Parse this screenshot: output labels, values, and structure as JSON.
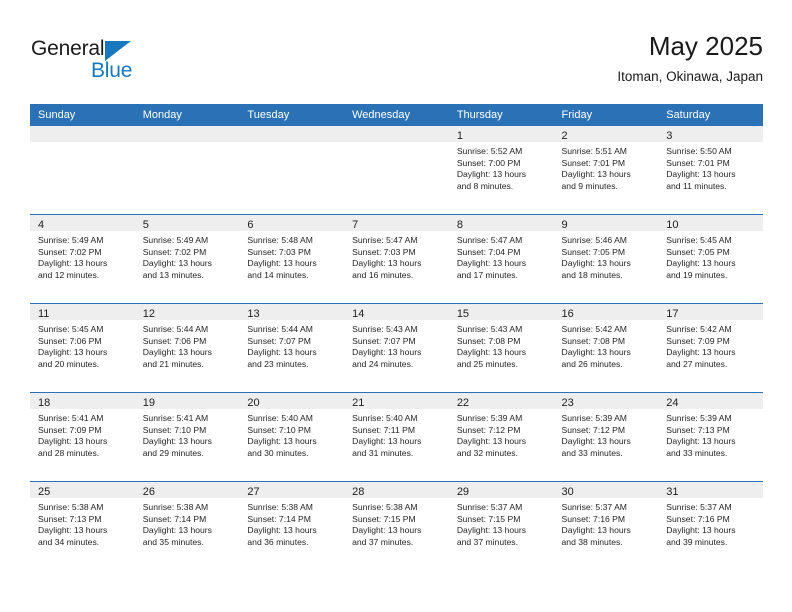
{
  "brand": {
    "name_part1": "General",
    "name_part2": "Blue",
    "triangle_color": "#1878be"
  },
  "header": {
    "title": "May 2025",
    "subtitle": "Itoman, Okinawa, Japan"
  },
  "theme": {
    "header_bg": "#2a72b5",
    "daynum_bg": "#eeeeee",
    "row_divider": "#2a72b5",
    "text": "#252525"
  },
  "calendar": {
    "weekday_headers": [
      "Sunday",
      "Monday",
      "Tuesday",
      "Wednesday",
      "Thursday",
      "Friday",
      "Saturday"
    ],
    "weeks": [
      [
        {
          "day": "",
          "lines": []
        },
        {
          "day": "",
          "lines": []
        },
        {
          "day": "",
          "lines": []
        },
        {
          "day": "",
          "lines": []
        },
        {
          "day": "1",
          "lines": [
            "Sunrise: 5:52 AM",
            "Sunset: 7:00 PM",
            "Daylight: 13 hours",
            "and 8 minutes."
          ]
        },
        {
          "day": "2",
          "lines": [
            "Sunrise: 5:51 AM",
            "Sunset: 7:01 PM",
            "Daylight: 13 hours",
            "and 9 minutes."
          ]
        },
        {
          "day": "3",
          "lines": [
            "Sunrise: 5:50 AM",
            "Sunset: 7:01 PM",
            "Daylight: 13 hours",
            "and 11 minutes."
          ]
        }
      ],
      [
        {
          "day": "4",
          "lines": [
            "Sunrise: 5:49 AM",
            "Sunset: 7:02 PM",
            "Daylight: 13 hours",
            "and 12 minutes."
          ]
        },
        {
          "day": "5",
          "lines": [
            "Sunrise: 5:49 AM",
            "Sunset: 7:02 PM",
            "Daylight: 13 hours",
            "and 13 minutes."
          ]
        },
        {
          "day": "6",
          "lines": [
            "Sunrise: 5:48 AM",
            "Sunset: 7:03 PM",
            "Daylight: 13 hours",
            "and 14 minutes."
          ]
        },
        {
          "day": "7",
          "lines": [
            "Sunrise: 5:47 AM",
            "Sunset: 7:03 PM",
            "Daylight: 13 hours",
            "and 16 minutes."
          ]
        },
        {
          "day": "8",
          "lines": [
            "Sunrise: 5:47 AM",
            "Sunset: 7:04 PM",
            "Daylight: 13 hours",
            "and 17 minutes."
          ]
        },
        {
          "day": "9",
          "lines": [
            "Sunrise: 5:46 AM",
            "Sunset: 7:05 PM",
            "Daylight: 13 hours",
            "and 18 minutes."
          ]
        },
        {
          "day": "10",
          "lines": [
            "Sunrise: 5:45 AM",
            "Sunset: 7:05 PM",
            "Daylight: 13 hours",
            "and 19 minutes."
          ]
        }
      ],
      [
        {
          "day": "11",
          "lines": [
            "Sunrise: 5:45 AM",
            "Sunset: 7:06 PM",
            "Daylight: 13 hours",
            "and 20 minutes."
          ]
        },
        {
          "day": "12",
          "lines": [
            "Sunrise: 5:44 AM",
            "Sunset: 7:06 PM",
            "Daylight: 13 hours",
            "and 21 minutes."
          ]
        },
        {
          "day": "13",
          "lines": [
            "Sunrise: 5:44 AM",
            "Sunset: 7:07 PM",
            "Daylight: 13 hours",
            "and 23 minutes."
          ]
        },
        {
          "day": "14",
          "lines": [
            "Sunrise: 5:43 AM",
            "Sunset: 7:07 PM",
            "Daylight: 13 hours",
            "and 24 minutes."
          ]
        },
        {
          "day": "15",
          "lines": [
            "Sunrise: 5:43 AM",
            "Sunset: 7:08 PM",
            "Daylight: 13 hours",
            "and 25 minutes."
          ]
        },
        {
          "day": "16",
          "lines": [
            "Sunrise: 5:42 AM",
            "Sunset: 7:08 PM",
            "Daylight: 13 hours",
            "and 26 minutes."
          ]
        },
        {
          "day": "17",
          "lines": [
            "Sunrise: 5:42 AM",
            "Sunset: 7:09 PM",
            "Daylight: 13 hours",
            "and 27 minutes."
          ]
        }
      ],
      [
        {
          "day": "18",
          "lines": [
            "Sunrise: 5:41 AM",
            "Sunset: 7:09 PM",
            "Daylight: 13 hours",
            "and 28 minutes."
          ]
        },
        {
          "day": "19",
          "lines": [
            "Sunrise: 5:41 AM",
            "Sunset: 7:10 PM",
            "Daylight: 13 hours",
            "and 29 minutes."
          ]
        },
        {
          "day": "20",
          "lines": [
            "Sunrise: 5:40 AM",
            "Sunset: 7:10 PM",
            "Daylight: 13 hours",
            "and 30 minutes."
          ]
        },
        {
          "day": "21",
          "lines": [
            "Sunrise: 5:40 AM",
            "Sunset: 7:11 PM",
            "Daylight: 13 hours",
            "and 31 minutes."
          ]
        },
        {
          "day": "22",
          "lines": [
            "Sunrise: 5:39 AM",
            "Sunset: 7:12 PM",
            "Daylight: 13 hours",
            "and 32 minutes."
          ]
        },
        {
          "day": "23",
          "lines": [
            "Sunrise: 5:39 AM",
            "Sunset: 7:12 PM",
            "Daylight: 13 hours",
            "and 33 minutes."
          ]
        },
        {
          "day": "24",
          "lines": [
            "Sunrise: 5:39 AM",
            "Sunset: 7:13 PM",
            "Daylight: 13 hours",
            "and 33 minutes."
          ]
        }
      ],
      [
        {
          "day": "25",
          "lines": [
            "Sunrise: 5:38 AM",
            "Sunset: 7:13 PM",
            "Daylight: 13 hours",
            "and 34 minutes."
          ]
        },
        {
          "day": "26",
          "lines": [
            "Sunrise: 5:38 AM",
            "Sunset: 7:14 PM",
            "Daylight: 13 hours",
            "and 35 minutes."
          ]
        },
        {
          "day": "27",
          "lines": [
            "Sunrise: 5:38 AM",
            "Sunset: 7:14 PM",
            "Daylight: 13 hours",
            "and 36 minutes."
          ]
        },
        {
          "day": "28",
          "lines": [
            "Sunrise: 5:38 AM",
            "Sunset: 7:15 PM",
            "Daylight: 13 hours",
            "and 37 minutes."
          ]
        },
        {
          "day": "29",
          "lines": [
            "Sunrise: 5:37 AM",
            "Sunset: 7:15 PM",
            "Daylight: 13 hours",
            "and 37 minutes."
          ]
        },
        {
          "day": "30",
          "lines": [
            "Sunrise: 5:37 AM",
            "Sunset: 7:16 PM",
            "Daylight: 13 hours",
            "and 38 minutes."
          ]
        },
        {
          "day": "31",
          "lines": [
            "Sunrise: 5:37 AM",
            "Sunset: 7:16 PM",
            "Daylight: 13 hours",
            "and 39 minutes."
          ]
        }
      ]
    ]
  }
}
